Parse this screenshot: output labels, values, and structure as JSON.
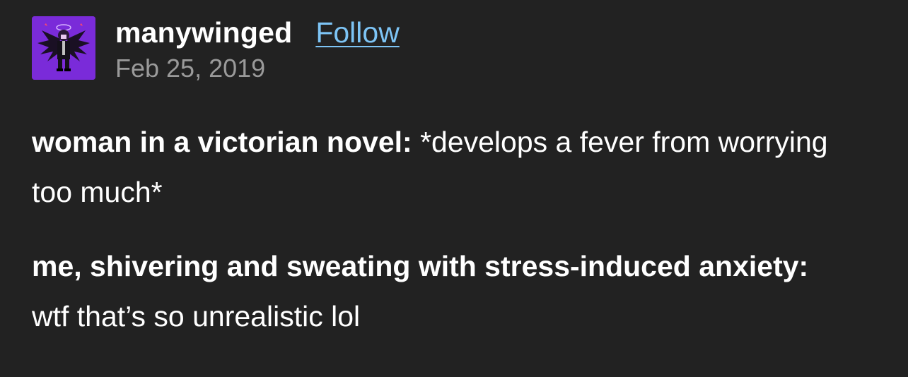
{
  "author": {
    "username": "manywinged",
    "follow_label": "Follow",
    "date": "Feb 25, 2019",
    "avatar_icon": "winged-figure-avatar"
  },
  "post": {
    "paragraphs": [
      {
        "speaker": "woman in a victorian novel:",
        "text": " *develops a fever from worrying too much*"
      },
      {
        "speaker": "me, shivering and sweating with stress-induced anxiety:",
        "text": " wtf that’s so unrealistic lol"
      }
    ]
  },
  "colors": {
    "background": "#222222",
    "text": "#ffffff",
    "link": "#7dc4f5",
    "muted": "#9a9a9a",
    "avatar_bg": "#7a2bd9"
  }
}
